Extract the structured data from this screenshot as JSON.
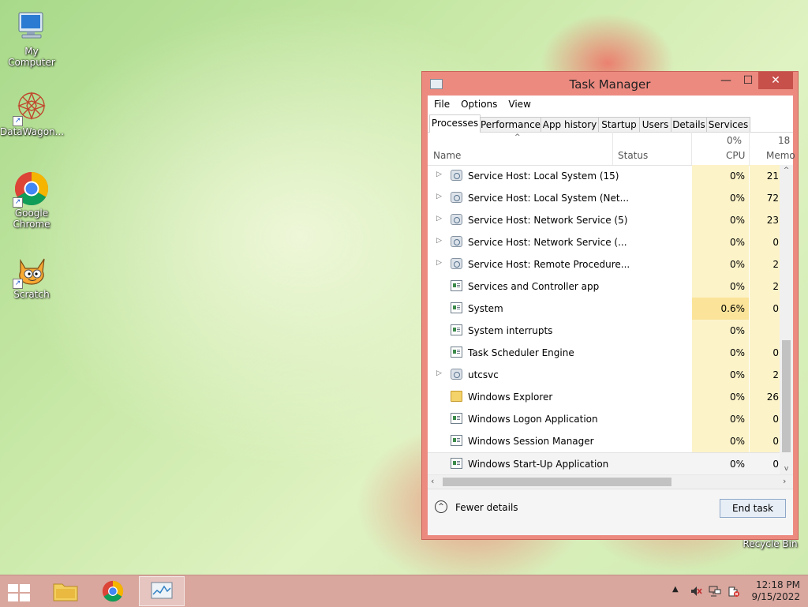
{
  "desktop": {
    "icons": [
      {
        "label": "My Computer"
      },
      {
        "label": "DataWagon..."
      },
      {
        "label": "Google Chrome"
      },
      {
        "label": "Scratch"
      },
      {
        "label": "Recycle Bin"
      }
    ]
  },
  "task_manager": {
    "title": "Task Manager",
    "window_buttons": {
      "minimize": "—",
      "maximize": "☐",
      "close": "✕"
    },
    "menu": [
      "File",
      "Options",
      "View"
    ],
    "tabs": [
      "Processes",
      "Performance",
      "App history",
      "Startup",
      "Users",
      "Details",
      "Services"
    ],
    "active_tab": "Processes",
    "columns": {
      "name": "Name",
      "status": "Status",
      "cpu": {
        "total": "0%",
        "label": "CPU"
      },
      "memory": {
        "total": "18",
        "label": "Memo"
      }
    },
    "rows": [
      {
        "name": "Service Host: Local System (15)",
        "cpu": "0%",
        "mem": "21",
        "icon": "gear-icon",
        "expandable": true
      },
      {
        "name": "Service Host: Local System (Net...",
        "cpu": "0%",
        "mem": "72",
        "icon": "gear-icon",
        "expandable": true
      },
      {
        "name": "Service Host: Network Service (5)",
        "cpu": "0%",
        "mem": "23",
        "icon": "gear-icon",
        "expandable": true
      },
      {
        "name": "Service Host: Network Service (...",
        "cpu": "0%",
        "mem": "0",
        "icon": "gear-icon",
        "expandable": true
      },
      {
        "name": "Service Host: Remote Procedure...",
        "cpu": "0%",
        "mem": "2",
        "icon": "gear-icon",
        "expandable": true
      },
      {
        "name": "Services and Controller app",
        "cpu": "0%",
        "mem": "2",
        "icon": "app-icon",
        "expandable": false
      },
      {
        "name": "System",
        "cpu": "0.6%",
        "mem": "0",
        "icon": "app-icon",
        "expandable": false
      },
      {
        "name": "System interrupts",
        "cpu": "0%",
        "mem": "",
        "icon": "app-icon",
        "expandable": false
      },
      {
        "name": "Task Scheduler Engine",
        "cpu": "0%",
        "mem": "0",
        "icon": "app-icon",
        "expandable": false
      },
      {
        "name": "utcsvc",
        "cpu": "0%",
        "mem": "2",
        "icon": "gear-icon",
        "expandable": true
      },
      {
        "name": "Windows Explorer",
        "cpu": "0%",
        "mem": "26",
        "icon": "folder-icon",
        "expandable": false
      },
      {
        "name": "Windows Logon Application",
        "cpu": "0%",
        "mem": "0",
        "icon": "app-icon",
        "expandable": false
      },
      {
        "name": "Windows Session Manager",
        "cpu": "0%",
        "mem": "0",
        "icon": "app-icon",
        "expandable": false
      },
      {
        "name": "Windows Start-Up Application",
        "cpu": "0%",
        "mem": "0",
        "icon": "app-icon",
        "expandable": false
      }
    ],
    "fewer_details": "Fewer details",
    "end_task": "End task"
  },
  "taskbar": {
    "clock_time": "12:18 PM",
    "clock_date": "9/15/2022",
    "tray_expand": "▲"
  },
  "colors": {
    "window_frame": "#ec8a80",
    "close_button": "#c7504a",
    "cpu_heat": "#fcf3c9",
    "taskbar": "#d9a79e"
  }
}
